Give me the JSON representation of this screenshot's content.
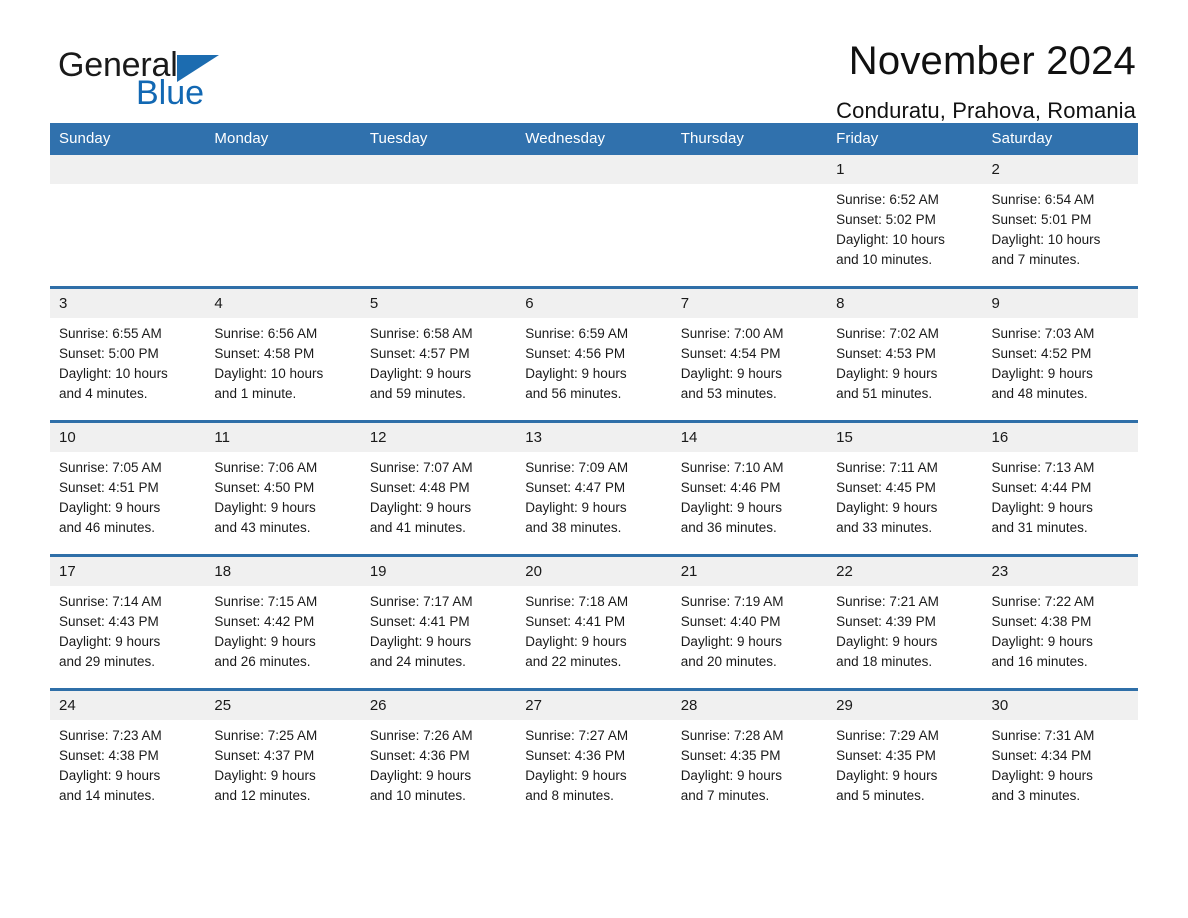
{
  "brand": {
    "name_part1": "General",
    "name_part2": "Blue",
    "accent_color": "#1268b3"
  },
  "header": {
    "title": "November 2024",
    "subtitle": "Conduratu, Prahova, Romania"
  },
  "calendar": {
    "header_bg": "#3071ad",
    "row_divider_color": "#2f6fa8",
    "daynum_bg": "#f0f0f0",
    "weekdays": [
      "Sunday",
      "Monday",
      "Tuesday",
      "Wednesday",
      "Thursday",
      "Friday",
      "Saturday"
    ],
    "weeks": [
      [
        {
          "day": "",
          "blank": true,
          "lines": []
        },
        {
          "day": "",
          "blank": true,
          "lines": []
        },
        {
          "day": "",
          "blank": true,
          "lines": []
        },
        {
          "day": "",
          "blank": true,
          "lines": []
        },
        {
          "day": "",
          "blank": true,
          "lines": []
        },
        {
          "day": "1",
          "blank": false,
          "lines": [
            "Sunrise: 6:52 AM",
            "Sunset: 5:02 PM",
            "Daylight: 10 hours",
            "and 10 minutes."
          ]
        },
        {
          "day": "2",
          "blank": false,
          "lines": [
            "Sunrise: 6:54 AM",
            "Sunset: 5:01 PM",
            "Daylight: 10 hours",
            "and 7 minutes."
          ]
        }
      ],
      [
        {
          "day": "3",
          "blank": false,
          "lines": [
            "Sunrise: 6:55 AM",
            "Sunset: 5:00 PM",
            "Daylight: 10 hours",
            "and 4 minutes."
          ]
        },
        {
          "day": "4",
          "blank": false,
          "lines": [
            "Sunrise: 6:56 AM",
            "Sunset: 4:58 PM",
            "Daylight: 10 hours",
            "and 1 minute."
          ]
        },
        {
          "day": "5",
          "blank": false,
          "lines": [
            "Sunrise: 6:58 AM",
            "Sunset: 4:57 PM",
            "Daylight: 9 hours",
            "and 59 minutes."
          ]
        },
        {
          "day": "6",
          "blank": false,
          "lines": [
            "Sunrise: 6:59 AM",
            "Sunset: 4:56 PM",
            "Daylight: 9 hours",
            "and 56 minutes."
          ]
        },
        {
          "day": "7",
          "blank": false,
          "lines": [
            "Sunrise: 7:00 AM",
            "Sunset: 4:54 PM",
            "Daylight: 9 hours",
            "and 53 minutes."
          ]
        },
        {
          "day": "8",
          "blank": false,
          "lines": [
            "Sunrise: 7:02 AM",
            "Sunset: 4:53 PM",
            "Daylight: 9 hours",
            "and 51 minutes."
          ]
        },
        {
          "day": "9",
          "blank": false,
          "lines": [
            "Sunrise: 7:03 AM",
            "Sunset: 4:52 PM",
            "Daylight: 9 hours",
            "and 48 minutes."
          ]
        }
      ],
      [
        {
          "day": "10",
          "blank": false,
          "lines": [
            "Sunrise: 7:05 AM",
            "Sunset: 4:51 PM",
            "Daylight: 9 hours",
            "and 46 minutes."
          ]
        },
        {
          "day": "11",
          "blank": false,
          "lines": [
            "Sunrise: 7:06 AM",
            "Sunset: 4:50 PM",
            "Daylight: 9 hours",
            "and 43 minutes."
          ]
        },
        {
          "day": "12",
          "blank": false,
          "lines": [
            "Sunrise: 7:07 AM",
            "Sunset: 4:48 PM",
            "Daylight: 9 hours",
            "and 41 minutes."
          ]
        },
        {
          "day": "13",
          "blank": false,
          "lines": [
            "Sunrise: 7:09 AM",
            "Sunset: 4:47 PM",
            "Daylight: 9 hours",
            "and 38 minutes."
          ]
        },
        {
          "day": "14",
          "blank": false,
          "lines": [
            "Sunrise: 7:10 AM",
            "Sunset: 4:46 PM",
            "Daylight: 9 hours",
            "and 36 minutes."
          ]
        },
        {
          "day": "15",
          "blank": false,
          "lines": [
            "Sunrise: 7:11 AM",
            "Sunset: 4:45 PM",
            "Daylight: 9 hours",
            "and 33 minutes."
          ]
        },
        {
          "day": "16",
          "blank": false,
          "lines": [
            "Sunrise: 7:13 AM",
            "Sunset: 4:44 PM",
            "Daylight: 9 hours",
            "and 31 minutes."
          ]
        }
      ],
      [
        {
          "day": "17",
          "blank": false,
          "lines": [
            "Sunrise: 7:14 AM",
            "Sunset: 4:43 PM",
            "Daylight: 9 hours",
            "and 29 minutes."
          ]
        },
        {
          "day": "18",
          "blank": false,
          "lines": [
            "Sunrise: 7:15 AM",
            "Sunset: 4:42 PM",
            "Daylight: 9 hours",
            "and 26 minutes."
          ]
        },
        {
          "day": "19",
          "blank": false,
          "lines": [
            "Sunrise: 7:17 AM",
            "Sunset: 4:41 PM",
            "Daylight: 9 hours",
            "and 24 minutes."
          ]
        },
        {
          "day": "20",
          "blank": false,
          "lines": [
            "Sunrise: 7:18 AM",
            "Sunset: 4:41 PM",
            "Daylight: 9 hours",
            "and 22 minutes."
          ]
        },
        {
          "day": "21",
          "blank": false,
          "lines": [
            "Sunrise: 7:19 AM",
            "Sunset: 4:40 PM",
            "Daylight: 9 hours",
            "and 20 minutes."
          ]
        },
        {
          "day": "22",
          "blank": false,
          "lines": [
            "Sunrise: 7:21 AM",
            "Sunset: 4:39 PM",
            "Daylight: 9 hours",
            "and 18 minutes."
          ]
        },
        {
          "day": "23",
          "blank": false,
          "lines": [
            "Sunrise: 7:22 AM",
            "Sunset: 4:38 PM",
            "Daylight: 9 hours",
            "and 16 minutes."
          ]
        }
      ],
      [
        {
          "day": "24",
          "blank": false,
          "lines": [
            "Sunrise: 7:23 AM",
            "Sunset: 4:38 PM",
            "Daylight: 9 hours",
            "and 14 minutes."
          ]
        },
        {
          "day": "25",
          "blank": false,
          "lines": [
            "Sunrise: 7:25 AM",
            "Sunset: 4:37 PM",
            "Daylight: 9 hours",
            "and 12 minutes."
          ]
        },
        {
          "day": "26",
          "blank": false,
          "lines": [
            "Sunrise: 7:26 AM",
            "Sunset: 4:36 PM",
            "Daylight: 9 hours",
            "and 10 minutes."
          ]
        },
        {
          "day": "27",
          "blank": false,
          "lines": [
            "Sunrise: 7:27 AM",
            "Sunset: 4:36 PM",
            "Daylight: 9 hours",
            "and 8 minutes."
          ]
        },
        {
          "day": "28",
          "blank": false,
          "lines": [
            "Sunrise: 7:28 AM",
            "Sunset: 4:35 PM",
            "Daylight: 9 hours",
            "and 7 minutes."
          ]
        },
        {
          "day": "29",
          "blank": false,
          "lines": [
            "Sunrise: 7:29 AM",
            "Sunset: 4:35 PM",
            "Daylight: 9 hours",
            "and 5 minutes."
          ]
        },
        {
          "day": "30",
          "blank": false,
          "lines": [
            "Sunrise: 7:31 AM",
            "Sunset: 4:34 PM",
            "Daylight: 9 hours",
            "and 3 minutes."
          ]
        }
      ]
    ]
  }
}
